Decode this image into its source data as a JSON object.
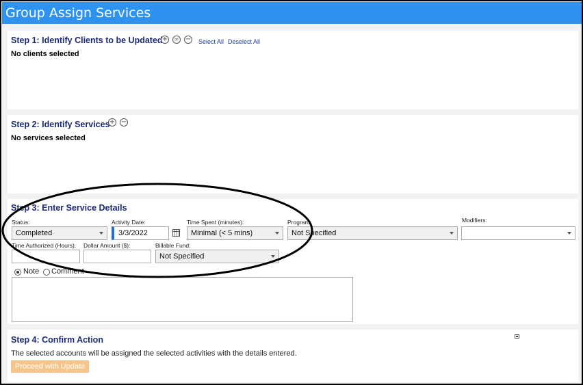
{
  "window": {
    "title": "Group Assign Services"
  },
  "step1": {
    "title": "Step 1: Identify Clients to be Updated",
    "select_all": "Select All",
    "deselect_all": "Deselect All",
    "icons": [
      "plus-circle-icon",
      "link-circle-icon",
      "minus-circle-icon"
    ],
    "message": "No clients selected"
  },
  "step2": {
    "title": "Step 2: Identify Services",
    "icons": [
      "plus-circle-icon",
      "minus-circle-icon"
    ],
    "message": "No services selected"
  },
  "step3": {
    "title": "Step 3: Enter Service Details",
    "status": {
      "label": "Status:",
      "value": "Completed"
    },
    "activity_date": {
      "label": "Activity Date:",
      "value": "3/3/2022"
    },
    "time_spent": {
      "label": "Time Spent (minutes):",
      "value": "Minimal (< 5 mins)"
    },
    "program": {
      "label": "Program:",
      "value": "Not Specified"
    },
    "modifiers": {
      "label": "Modifiers:",
      "value": ""
    },
    "time_authorized": {
      "label": "Time Authorized (Hours):",
      "value": ""
    },
    "dollar_amount": {
      "label": "Dollar Amount ($):",
      "value": ""
    },
    "billable_fund": {
      "label": "Billable Fund:",
      "value": "Not Specified"
    },
    "note_radio": {
      "label": "Note",
      "checked": true
    },
    "comment_radio": {
      "label": "Comment",
      "checked": false
    }
  },
  "step4": {
    "title": "Step 4: Confirm Action",
    "description": "The selected accounts will be assigned the selected activities with the details entered.",
    "button": "Proceed with Update"
  },
  "colors": {
    "titlebar": "#2e93f0",
    "section_title": "#1a2a78",
    "proceed_button": "#f7c58a",
    "date_accent": "#1f6fe0"
  }
}
